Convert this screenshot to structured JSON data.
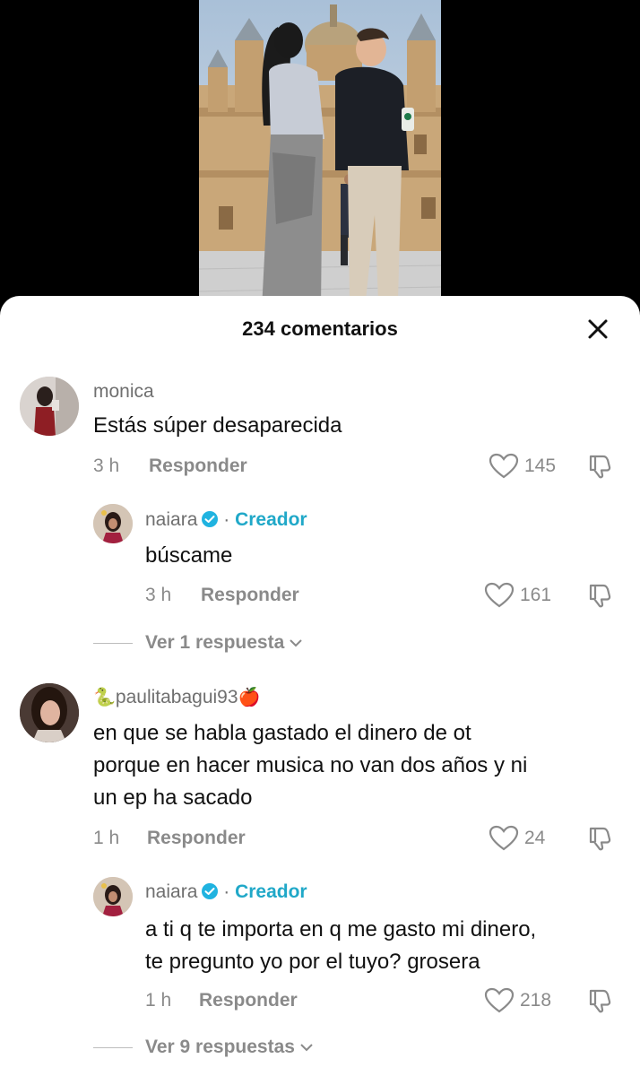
{
  "video": {
    "description_alt": ""
  },
  "sheet": {
    "title": "234 comentarios"
  },
  "comments": [
    {
      "username": "monica",
      "text": "Estás súper desaparecida",
      "time": "3 h",
      "reply_label": "Responder",
      "likes": "145"
    },
    {
      "username": "naiara",
      "creator_label": "Creador",
      "separator": "·",
      "text": "búscame",
      "time": "3 h",
      "reply_label": "Responder",
      "likes": "161",
      "view_replies": "Ver 1 respuesta"
    },
    {
      "username_prefix_emoji": "🐍",
      "username": "paulitabagui93",
      "username_suffix_emoji": "🍎",
      "text_lines": [
        "en que se habla gastado el dinero de ot",
        "porque en hacer musica no van dos años y ni",
        "un ep ha sacado"
      ],
      "time": "1 h",
      "reply_label": "Responder",
      "likes": "24"
    },
    {
      "username": "naiara",
      "creator_label": "Creador",
      "separator": "·",
      "text_lines": [
        "a ti q te importa en q me gasto mi dinero,",
        "te pregunto yo por el tuyo? grosera"
      ],
      "time": "1 h",
      "reply_label": "Responder",
      "likes": "218",
      "view_replies": "Ver 9 respuestas"
    }
  ],
  "icons": {
    "close": "close-icon",
    "heart": "heart-icon",
    "dislike": "dislike-icon",
    "verified": "verified-badge-icon",
    "chevron": "chevron-down-icon"
  },
  "colors": {
    "creator_accent": "#20a8c8",
    "secondary_text": "#8a8a8a"
  }
}
